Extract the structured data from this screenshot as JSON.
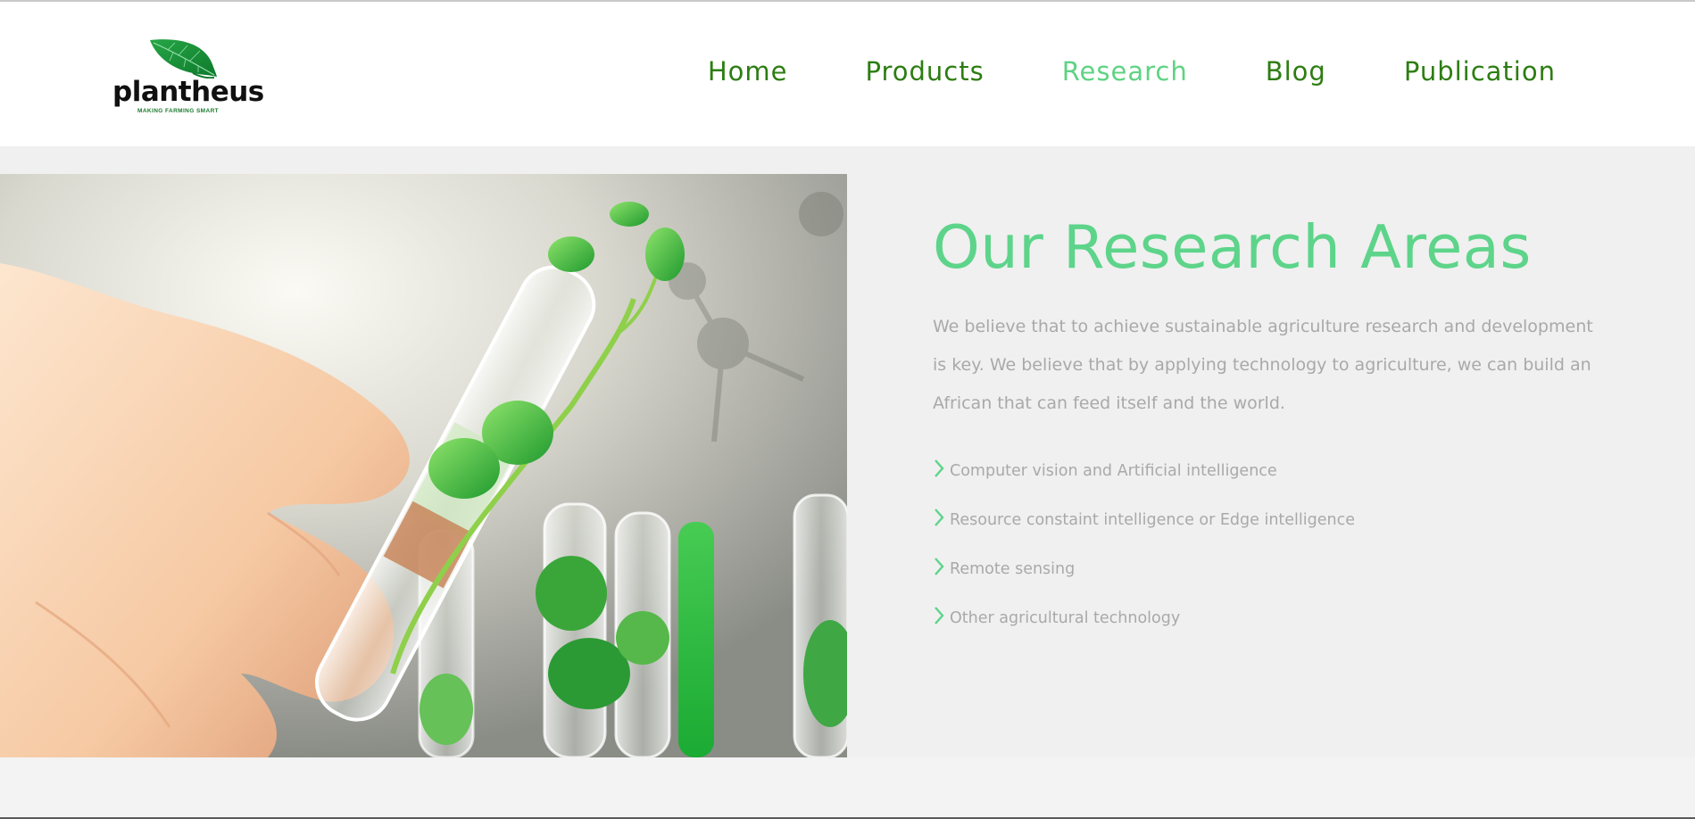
{
  "brand": {
    "name": "plantheus",
    "tagline": "MAKING FARMING SMART",
    "logo_icon": "leaf-icon",
    "color": "#1f9a3c"
  },
  "nav": {
    "items": [
      {
        "label": "Home",
        "active": false
      },
      {
        "label": "Products",
        "active": false
      },
      {
        "label": "Research",
        "active": true
      },
      {
        "label": "Blog",
        "active": false
      },
      {
        "label": "Publication",
        "active": false
      }
    ],
    "color": "#2d7d12",
    "active_color": "#5fd383"
  },
  "hero": {
    "title": "Our Research Areas",
    "description": "We believe that to achieve sustainable agriculture research and development is key. We believe that by applying technology to agriculture, we can build an African that can feed itself and the world.",
    "image": "lab-test-tube-seedling-image",
    "areas": [
      {
        "label": "Computer vision and Artificial intelligence",
        "icon": "chevron-right-icon"
      },
      {
        "label": "Resource constaint intelligence or Edge intelligence",
        "icon": "chevron-right-icon"
      },
      {
        "label": "Remote sensing",
        "icon": "chevron-right-icon"
      },
      {
        "label": "Other agricultural technology",
        "icon": "chevron-right-icon"
      }
    ]
  },
  "colors": {
    "accent_green": "#5dd48a",
    "muted_text": "#a9a9a9",
    "panel_bg": "#f0f0f0"
  }
}
